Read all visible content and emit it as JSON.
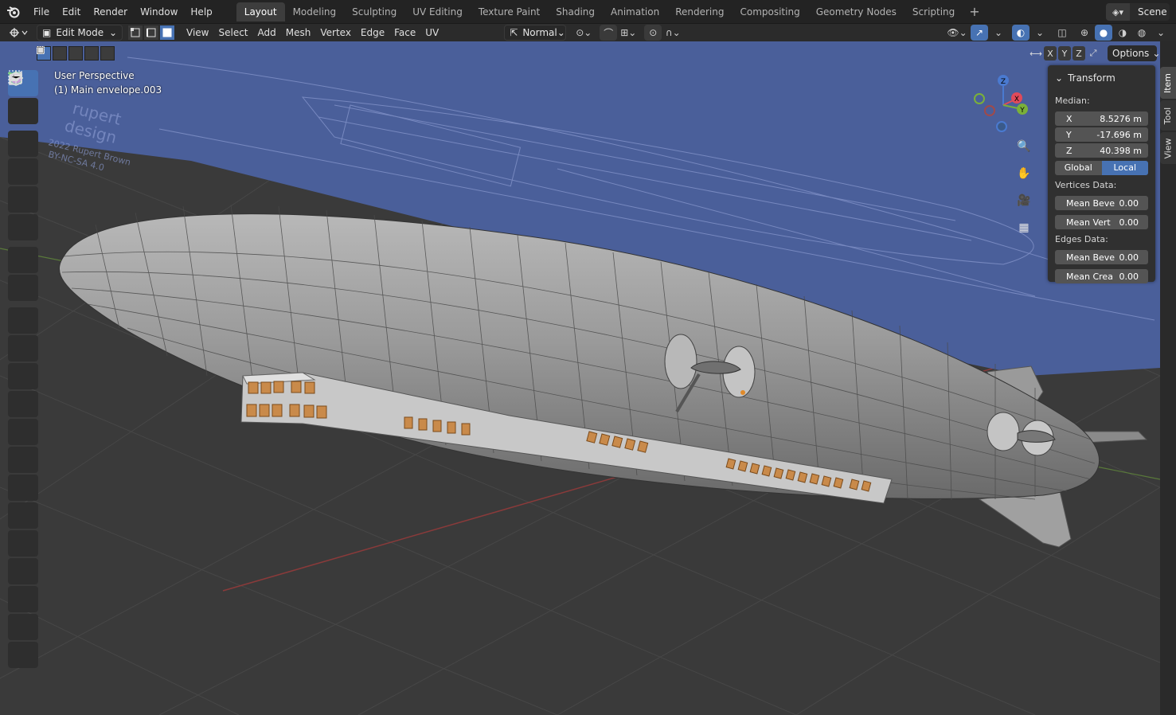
{
  "topbar": {
    "menus": [
      "File",
      "Edit",
      "Render",
      "Window",
      "Help"
    ],
    "workspaces": [
      "Layout",
      "Modeling",
      "Sculpting",
      "UV Editing",
      "Texture Paint",
      "Shading",
      "Animation",
      "Rendering",
      "Compositing",
      "Geometry Nodes",
      "Scripting"
    ],
    "active_workspace": "Layout",
    "scene": "Scene"
  },
  "header": {
    "mode": "Edit Mode",
    "menus": [
      "View",
      "Select",
      "Add",
      "Mesh",
      "Vertex",
      "Edge",
      "Face",
      "UV"
    ],
    "orientation": "Normal",
    "options_label": "Options",
    "axes": [
      "X",
      "Y",
      "Z"
    ]
  },
  "viewport": {
    "perspective": "User Perspective",
    "object": "(1) Main envelope.003"
  },
  "npanel": {
    "section": "Transform",
    "median_label": "Median:",
    "x_label": "X",
    "x_value": "8.5276 m",
    "y_label": "Y",
    "y_value": "-17.696 m",
    "z_label": "Z",
    "z_value": "40.398 m",
    "global": "Global",
    "local": "Local",
    "vertices_label": "Vertices Data:",
    "mean_bevel_v": "Mean Beve",
    "mean_bevel_v_val": "0.00",
    "mean_vert": "Mean Vert",
    "mean_vert_val": "0.00",
    "edges_label": "Edges Data:",
    "mean_bevel_e": "Mean Beve",
    "mean_bevel_e_val": "0.00",
    "mean_crease": "Mean Crea",
    "mean_crease_val": "0.00"
  },
  "side_tabs": [
    "Item",
    "Tool",
    "View"
  ],
  "gizmo": {
    "x": "X",
    "y": "Y",
    "z": "Z"
  },
  "blueprint_text": [
    "rupert",
    "design",
    "2022 Rupert Brown",
    "BY-NC-SA 4.0"
  ],
  "colors": {
    "accent": "#4772b3",
    "blueprint": "#4a5f9a",
    "mesh": "#8a8a8a",
    "selected_face": "#c98a4a"
  }
}
